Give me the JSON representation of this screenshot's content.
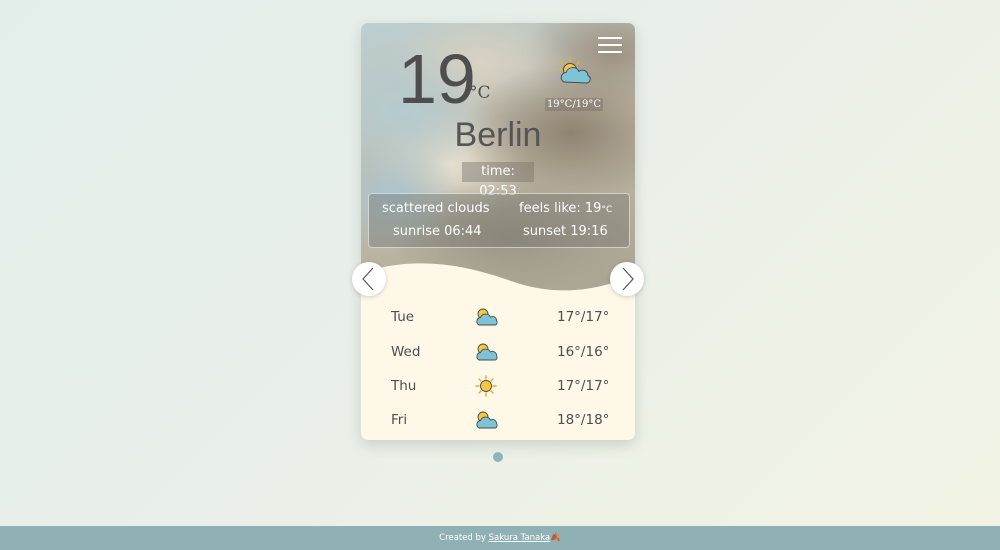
{
  "current": {
    "temp": "19",
    "unit": "°C",
    "minmax": "19°C/19°C",
    "icon": "partly-cloudy-icon",
    "city": "Berlin",
    "time": "time: 02:53",
    "description": "scattered clouds",
    "feels_like_label": "feels like: 19",
    "feels_like_unit": "°C",
    "sunrise": "sunrise 06:44",
    "sunset": "sunset 19:16"
  },
  "forecast": [
    {
      "day": "Tue",
      "icon": "partly-cloudy-icon",
      "range": "17°/17°"
    },
    {
      "day": "Wed",
      "icon": "partly-cloudy-icon",
      "range": "16°/16°"
    },
    {
      "day": "Thu",
      "icon": "sun-icon",
      "range": "17°/17°"
    },
    {
      "day": "Fri",
      "icon": "partly-cloudy-icon",
      "range": "18°/18°"
    }
  ],
  "nav": {
    "prev_icon": "chevron-left-icon",
    "next_icon": "chevron-right-icon"
  },
  "footer": {
    "prefix": "Created by ",
    "author": "Sakura Tanaka",
    "suffix": "🍂"
  },
  "colors": {
    "text_dark": "#4e4e4e",
    "card_bottom": "#fdf8e8",
    "footer_bg": "#8fb1b5",
    "dot": "#8fb3b8"
  }
}
